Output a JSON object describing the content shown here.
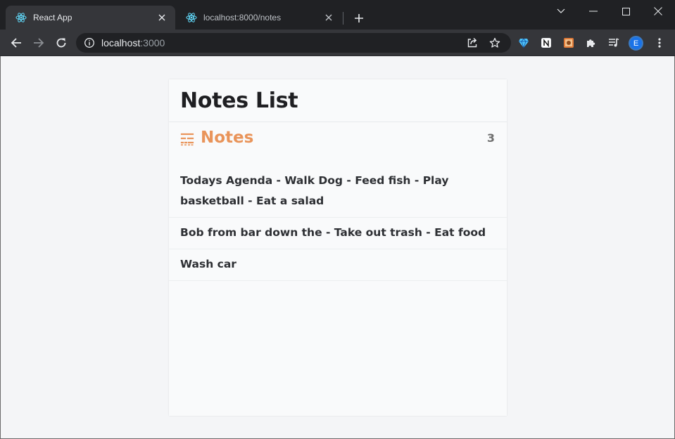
{
  "browser": {
    "tabs": [
      {
        "title": "React App",
        "active": true
      },
      {
        "title": "localhost:8000/notes",
        "active": false
      }
    ],
    "address": {
      "host": "localhost",
      "port": ":3000"
    },
    "avatar_initial": "E",
    "icons": [
      "react-favicon-icon",
      "close-icon",
      "plus-icon",
      "chevron-down-icon",
      "minimize-icon",
      "maximize-icon",
      "window-close-icon",
      "back-icon",
      "forward-icon",
      "reload-icon",
      "info-icon",
      "share-icon",
      "star-icon",
      "extension-gem-icon",
      "notion-icon",
      "extension-image-icon",
      "puzzle-icon",
      "media-queue-icon",
      "menu-dots-icon"
    ]
  },
  "page": {
    "title": "Notes List",
    "notes_label": "Notes",
    "notes_count": "3",
    "notes": [
      "Todays Agenda - Walk Dog - Feed fish - Play basketball - Eat a salad",
      "Bob from bar down the - Take out trash - Eat food",
      "Wash car"
    ],
    "accent_color": "#e9945a"
  }
}
